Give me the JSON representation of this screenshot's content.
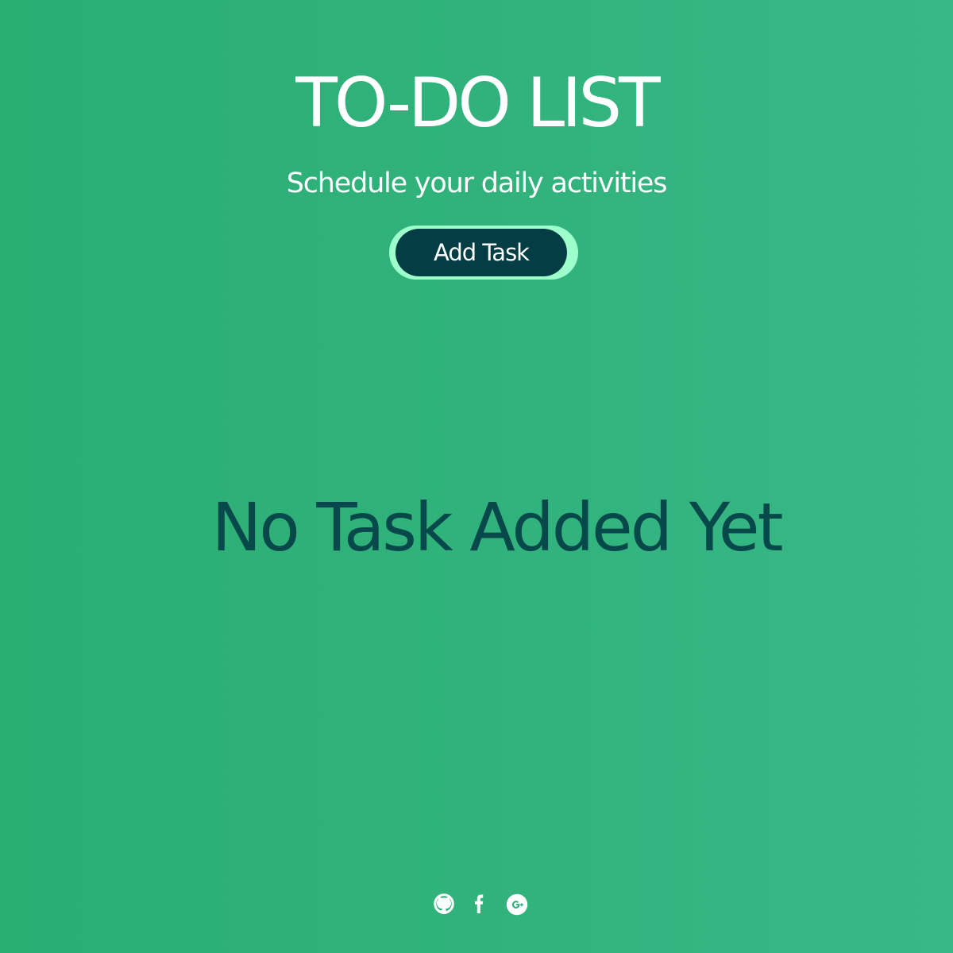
{
  "header": {
    "title": "TO-DO LIST",
    "subtitle": "Schedule your daily activities"
  },
  "actions": {
    "add_task_label": "Add Task"
  },
  "tasks": {
    "empty_message": "No Task Added Yet"
  },
  "footer": {
    "links": [
      {
        "icon": "github-icon"
      },
      {
        "icon": "facebook-icon"
      },
      {
        "icon": "google-plus-icon"
      }
    ]
  },
  "colors": {
    "background_start": "#2aae72",
    "background_end": "#37b886",
    "button_background": "#043e44",
    "button_ring": "#9dffcb",
    "empty_text": "#07484a",
    "text": "#ffffff"
  }
}
